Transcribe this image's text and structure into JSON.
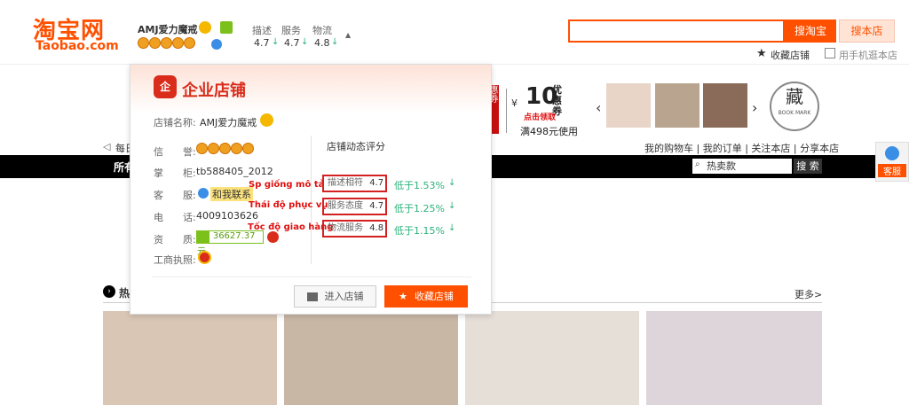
{
  "header": {
    "logo_cn": "淘宝网",
    "logo_en": "Taobao.com",
    "seller_name": "AMJ爱力魔戒",
    "stats": [
      {
        "label": "描述",
        "value": "4.7"
      },
      {
        "label": "服务",
        "value": "4.7"
      },
      {
        "label": "物流",
        "value": "4.8"
      }
    ],
    "search_placeholder": "",
    "search_taobao_label": "搜淘宝",
    "search_shop_label": "搜本店",
    "collect_shop_label": "收藏店铺",
    "mobile_shop_label": "用手机逛本店"
  },
  "banner": {
    "promo_number": "10",
    "promo_unit": "优惠券",
    "promo_click": "点击领取",
    "promo_text": "满498元使用",
    "bookmark_char": "藏",
    "bookmark_text": "BOOK MARK",
    "left_chars": "惠券"
  },
  "links": {
    "cart": "我的购物车",
    "orders": "我的订单",
    "follow": "关注本店",
    "share": "分享本店",
    "announce_prefix": "每日",
    "nav_all": "所有"
  },
  "shop_search": {
    "placeholder": "热卖款",
    "button": "搜 索"
  },
  "popup": {
    "title": "企业店铺",
    "shop_name_label": "店铺名称:",
    "shop_name": "AMJ爱力魔戒",
    "rows": [
      {
        "label": "信　　誉:",
        "value": ""
      },
      {
        "label": "掌　　柜:",
        "value": "tb588405_2012"
      },
      {
        "label": "客　　服:",
        "value": "和我联系"
      },
      {
        "label": "电　　话:",
        "value": "4009103626"
      },
      {
        "label": "资　　质:",
        "value": "36627.37元"
      },
      {
        "label": "工商执照:",
        "value": ""
      }
    ],
    "ratings_title": "店铺动态评分",
    "ratings": [
      {
        "label": "描述相符",
        "score": "4.7",
        "compare": "低于1.53%",
        "annotation": "Sp giống mô tả"
      },
      {
        "label": "服务态度",
        "score": "4.7",
        "compare": "低于1.25%",
        "annotation": "Thái độ phục vụ"
      },
      {
        "label": "物流服务",
        "score": "4.8",
        "compare": "低于1.15%",
        "annotation": "Tốc độ giao hàng"
      }
    ],
    "enter_shop": "进入店铺",
    "collect_shop": "收藏店铺"
  },
  "section": {
    "more": "更多>",
    "hot_prefix": "热"
  },
  "service": {
    "label": "客服"
  },
  "colors": {
    "brand": "#ff5000",
    "green": "#2bb37a",
    "annotation_red": "#e01010"
  }
}
